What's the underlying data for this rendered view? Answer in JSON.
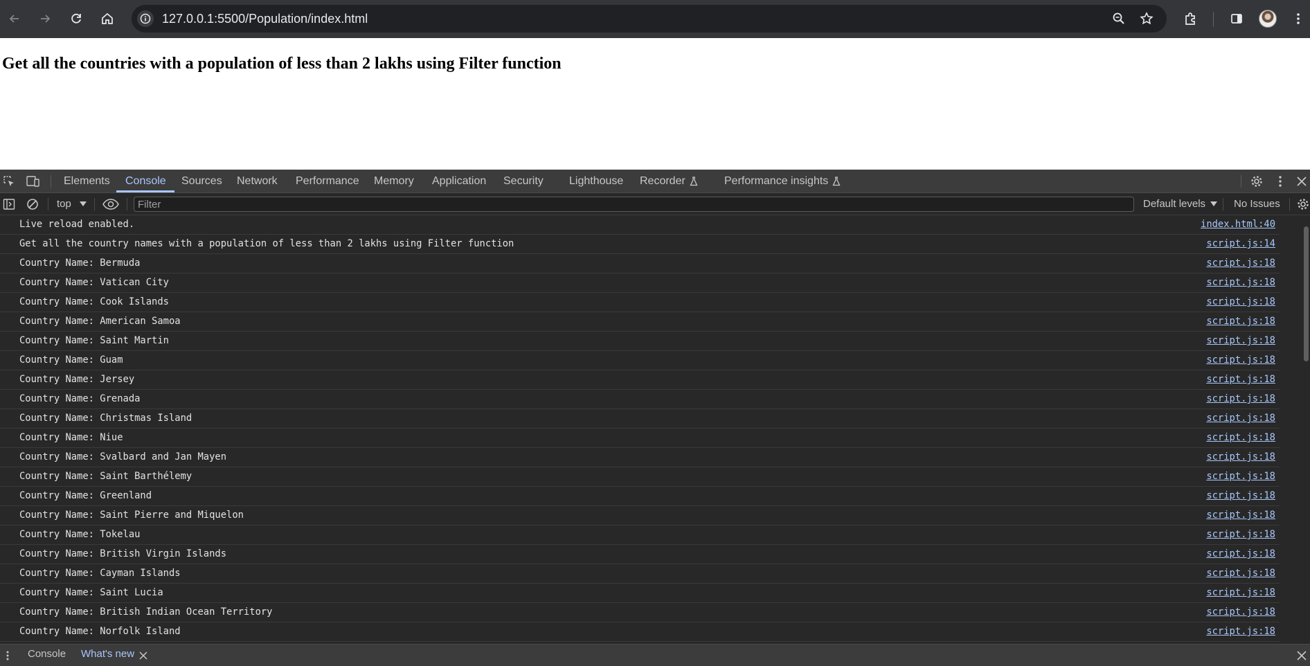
{
  "browser": {
    "url": "127.0.0.1:5500/Population/index.html"
  },
  "page": {
    "heading": "Get all the countries with a population of less than 2 lakhs using Filter function"
  },
  "devtools": {
    "tabs": {
      "elements": "Elements",
      "console": "Console",
      "sources": "Sources",
      "network": "Network",
      "performance": "Performance",
      "memory": "Memory",
      "application": "Application",
      "security": "Security",
      "lighthouse": "Lighthouse",
      "recorder": "Recorder",
      "performance_insights": "Performance insights"
    },
    "filter_bar": {
      "context": "top",
      "filter_placeholder": "Filter",
      "levels": "Default levels",
      "issues": "No Issues"
    },
    "console_messages": [
      {
        "text": "Live reload enabled.",
        "source": "index.html:40"
      },
      {
        "text": "Get all the country names with a population of less than 2 lakhs using Filter function",
        "source": "script.js:14"
      },
      {
        "text": "Country Name: Bermuda",
        "source": "script.js:18"
      },
      {
        "text": "Country Name: Vatican City",
        "source": "script.js:18"
      },
      {
        "text": "Country Name: Cook Islands",
        "source": "script.js:18"
      },
      {
        "text": "Country Name: American Samoa",
        "source": "script.js:18"
      },
      {
        "text": "Country Name: Saint Martin",
        "source": "script.js:18"
      },
      {
        "text": "Country Name: Guam",
        "source": "script.js:18"
      },
      {
        "text": "Country Name: Jersey",
        "source": "script.js:18"
      },
      {
        "text": "Country Name: Grenada",
        "source": "script.js:18"
      },
      {
        "text": "Country Name: Christmas Island",
        "source": "script.js:18"
      },
      {
        "text": "Country Name: Niue",
        "source": "script.js:18"
      },
      {
        "text": "Country Name: Svalbard and Jan Mayen",
        "source": "script.js:18"
      },
      {
        "text": "Country Name: Saint Barthélemy",
        "source": "script.js:18"
      },
      {
        "text": "Country Name: Greenland",
        "source": "script.js:18"
      },
      {
        "text": "Country Name: Saint Pierre and Miquelon",
        "source": "script.js:18"
      },
      {
        "text": "Country Name: Tokelau",
        "source": "script.js:18"
      },
      {
        "text": "Country Name: British Virgin Islands",
        "source": "script.js:18"
      },
      {
        "text": "Country Name: Cayman Islands",
        "source": "script.js:18"
      },
      {
        "text": "Country Name: Saint Lucia",
        "source": "script.js:18"
      },
      {
        "text": "Country Name: British Indian Ocean Territory",
        "source": "script.js:18"
      },
      {
        "text": "Country Name: Norfolk Island",
        "source": "script.js:18"
      }
    ],
    "drawer": {
      "console_tab": "Console",
      "whats_new_tab": "What's new"
    }
  }
}
